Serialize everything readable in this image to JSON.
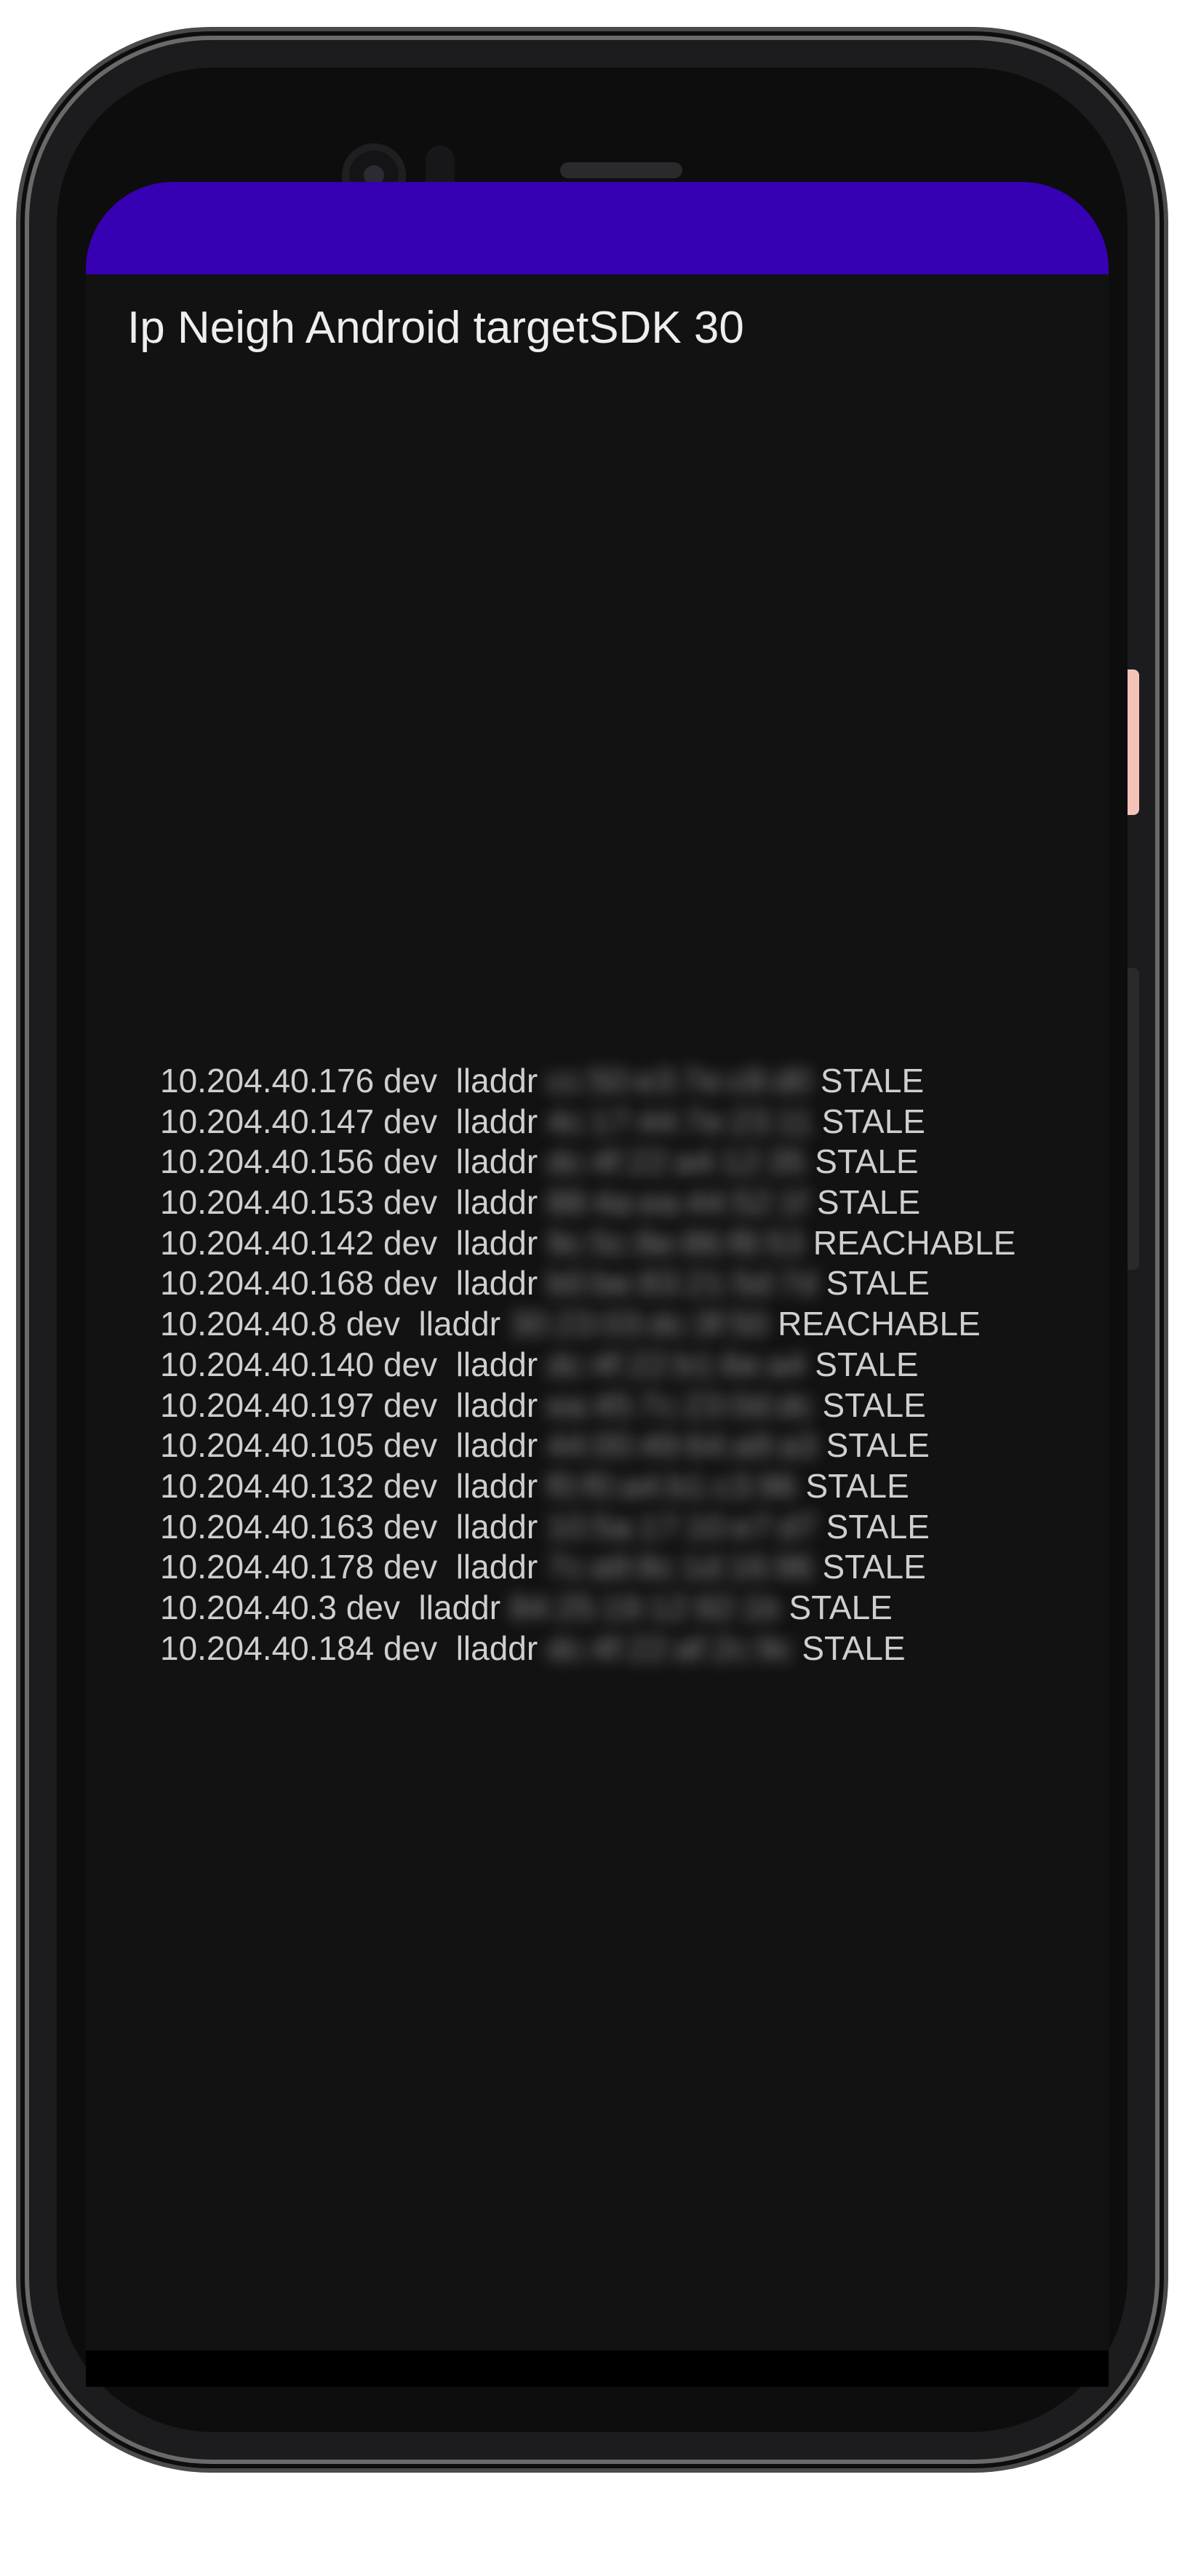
{
  "app": {
    "title": "Ip Neigh Android targetSDK 30",
    "status_bar_color": "#3700b3",
    "background_color": "#121212"
  },
  "neighbors": [
    {
      "ip": "10.204.40.176",
      "dev": "dev",
      "lladdr_label": "lladdr",
      "mac": "cc:50:e3:7e:c8:d0",
      "state": "STALE"
    },
    {
      "ip": "10.204.40.147",
      "dev": "dev",
      "lladdr_label": "lladdr",
      "mac": "4c:17:44:7e:23:11",
      "state": "STALE"
    },
    {
      "ip": "10.204.40.156",
      "dev": "dev",
      "lladdr_label": "lladdr",
      "mac": "dc:4f:22:a4:12:35",
      "state": "STALE"
    },
    {
      "ip": "10.204.40.153",
      "dev": "dev",
      "lladdr_label": "lladdr",
      "mac": "88:4a:ea:44:52:1f",
      "state": "STALE"
    },
    {
      "ip": "10.204.40.142",
      "dev": "dev",
      "lladdr_label": "lladdr",
      "mac": "9c:5c:8e:86:f8:53",
      "state": "REACHABLE"
    },
    {
      "ip": "10.204.40.168",
      "dev": "dev",
      "lladdr_label": "lladdr",
      "mac": "b0:be:83:21:5d:7d",
      "state": "STALE"
    },
    {
      "ip": "10.204.40.8",
      "dev": "dev",
      "lladdr_label": "lladdr",
      "mac": "30:23:03:dc:3f:50",
      "state": "REACHABLE"
    },
    {
      "ip": "10.204.40.140",
      "dev": "dev",
      "lladdr_label": "lladdr",
      "mac": "dc:4f:22:b1:6e:a4",
      "state": "STALE"
    },
    {
      "ip": "10.204.40.197",
      "dev": "dev",
      "lladdr_label": "lladdr",
      "mac": "ea:45:7c:23:0d:dc",
      "state": "STALE"
    },
    {
      "ip": "10.204.40.105",
      "dev": "dev",
      "lladdr_label": "lladdr",
      "mac": "44:00:49:64:a9:a3",
      "state": "STALE"
    },
    {
      "ip": "10.204.40.132",
      "dev": "dev",
      "lladdr_label": "lladdr",
      "mac": "f0:f0:a4:b1:c3:96",
      "state": "STALE"
    },
    {
      "ip": "10.204.40.163",
      "dev": "dev",
      "lladdr_label": "lladdr",
      "mac": "10:5a:17:10:e7:d7",
      "state": "STALE"
    },
    {
      "ip": "10.204.40.178",
      "dev": "dev",
      "lladdr_label": "lladdr",
      "mac": "7c:a9:8c:1d:16:96",
      "state": "STALE"
    },
    {
      "ip": "10.204.40.3",
      "dev": "dev",
      "lladdr_label": "lladdr",
      "mac": "84:25:19:12:92:1b",
      "state": "STALE"
    },
    {
      "ip": "10.204.40.184",
      "dev": "dev",
      "lladdr_label": "lladdr",
      "mac": "dc:4f:22:af:2c:9c",
      "state": "STALE"
    }
  ]
}
